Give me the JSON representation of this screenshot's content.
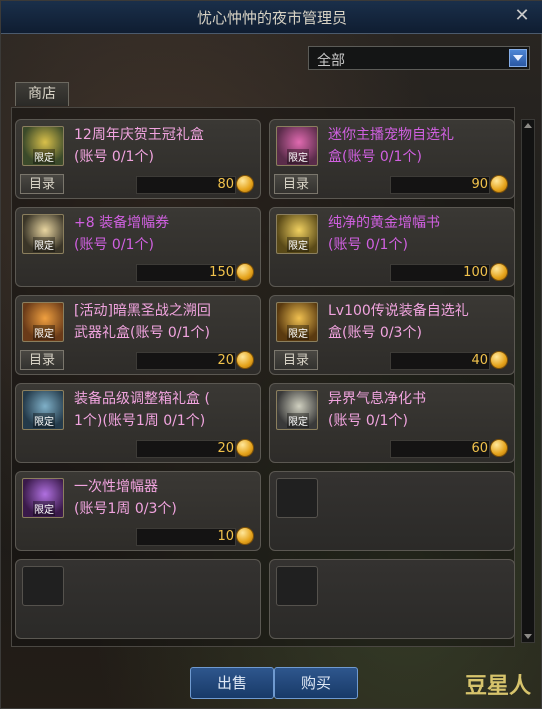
{
  "window": {
    "title": "忧心忡忡的夜市管理员",
    "close_label": "✕"
  },
  "filter": {
    "selected": "全部"
  },
  "tabs": {
    "shop": "商店"
  },
  "catalog_label": "目录",
  "items": [
    {
      "name": "12周年庆贺王冠礼盒",
      "limit": "(账号 0/1个)",
      "price": "80",
      "badge": "限定",
      "has_catalog": true,
      "name_color": "#f1a4df",
      "icon": "crown-box-icon"
    },
    {
      "name": "迷你主播宠物自选礼",
      "limit": "盒(账号 0/1个)",
      "price": "90",
      "badge": "限定",
      "has_catalog": true,
      "name_color": "#d060e0",
      "icon": "pet-box-icon"
    },
    {
      "name": "+8 装备增幅券",
      "limit": "(账号 0/1个)",
      "price": "150",
      "badge": "限定",
      "has_catalog": false,
      "name_color": "#d060e0",
      "icon": "amplify-ticket-icon"
    },
    {
      "name": "纯净的黄金增幅书",
      "limit": "(账号 0/1个)",
      "price": "100",
      "badge": "限定",
      "has_catalog": false,
      "name_color": "#d060e0",
      "icon": "golden-book-icon"
    },
    {
      "name": "[活动]暗黑圣战之溯回",
      "limit": "武器礼盒(账号 0/1个)",
      "price": "20",
      "badge": "限定",
      "has_catalog": true,
      "name_color": "#f1a4df",
      "icon": "weapon-box-icon"
    },
    {
      "name": "Lv100传说装备自选礼",
      "limit": "盒(账号 0/3个)",
      "price": "40",
      "badge": "限定",
      "has_catalog": true,
      "name_color": "#f1a4df",
      "icon": "legend-box-icon"
    },
    {
      "name": "装备品级调整箱礼盒 (",
      "limit": "1个)(账号1周 0/1个)",
      "price": "20",
      "badge": "限定",
      "has_catalog": false,
      "name_color": "#f1a4df",
      "icon": "grade-box-icon"
    },
    {
      "name": "异界气息净化书",
      "limit": "(账号 0/1个)",
      "price": "60",
      "badge": "限定",
      "has_catalog": false,
      "name_color": "#f1a4df",
      "icon": "purify-book-icon"
    },
    {
      "name": "一次性增幅器",
      "limit": "(账号1周 0/3个)",
      "price": "10",
      "badge": "限定",
      "has_catalog": false,
      "name_color": "#f1a4df",
      "icon": "amplifier-icon"
    }
  ],
  "buttons": {
    "sell": "出售",
    "buy": "购买"
  },
  "watermark": "豆星人"
}
